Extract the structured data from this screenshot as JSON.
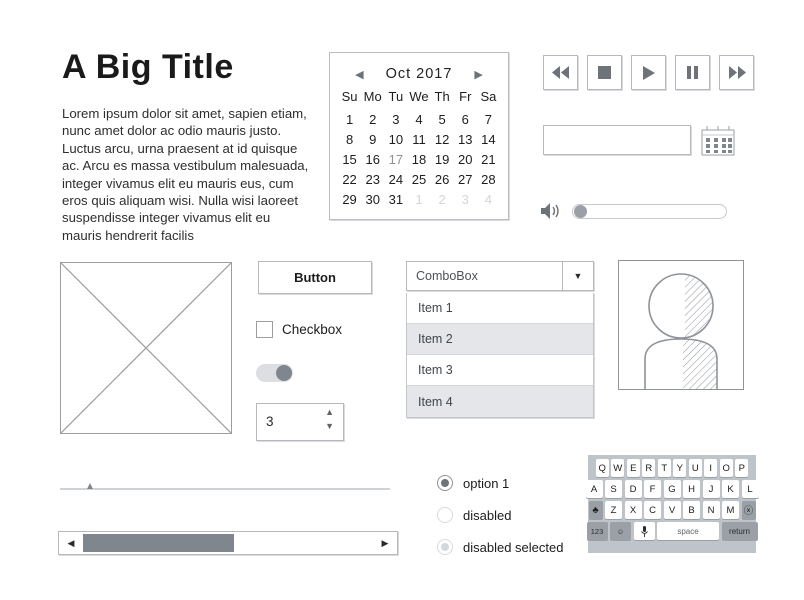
{
  "title": "A Big Title",
  "paragraph": "Lorem ipsum dolor sit amet, sapien etiam, nunc amet dolor ac odio mauris justo. Luctus arcu, urna praesent at id quisque ac. Arcu es massa vestibulum malesuada, integer vivamus elit eu mauris eus, cum eros quis aliquam wisi. Nulla wisi laoreet suspendisse integer vivamus elit eu mauris hendrerit facilis",
  "calendar": {
    "prev_icon": "◀",
    "next_icon": "▶",
    "month": "Oct",
    "year": "2017",
    "month_year": "Oct  2017",
    "weekdays": [
      "Su",
      "Mo",
      "Tu",
      "We",
      "Th",
      "Fr",
      "Sa"
    ],
    "weeks": [
      [
        {
          "d": "1"
        },
        {
          "d": "2"
        },
        {
          "d": "3"
        },
        {
          "d": "4"
        },
        {
          "d": "5"
        },
        {
          "d": "6"
        },
        {
          "d": "7"
        }
      ],
      [
        {
          "d": "8"
        },
        {
          "d": "9"
        },
        {
          "d": "10"
        },
        {
          "d": "11"
        },
        {
          "d": "12"
        },
        {
          "d": "13"
        },
        {
          "d": "14"
        }
      ],
      [
        {
          "d": "15"
        },
        {
          "d": "16"
        },
        {
          "d": "17",
          "state": "today"
        },
        {
          "d": "18"
        },
        {
          "d": "19"
        },
        {
          "d": "20"
        },
        {
          "d": "21"
        }
      ],
      [
        {
          "d": "22"
        },
        {
          "d": "23"
        },
        {
          "d": "24"
        },
        {
          "d": "25"
        },
        {
          "d": "26"
        },
        {
          "d": "27"
        },
        {
          "d": "28"
        }
      ],
      [
        {
          "d": "29"
        },
        {
          "d": "30"
        },
        {
          "d": "31"
        },
        {
          "d": "1",
          "state": "muted"
        },
        {
          "d": "2",
          "state": "muted"
        },
        {
          "d": "3",
          "state": "muted"
        },
        {
          "d": "4",
          "state": "muted"
        }
      ]
    ]
  },
  "media_buttons": [
    {
      "name": "rewind",
      "icon": "rewind-icon"
    },
    {
      "name": "stop",
      "icon": "stop-icon"
    },
    {
      "name": "play",
      "icon": "play-icon"
    },
    {
      "name": "pause",
      "icon": "pause-icon"
    },
    {
      "name": "fast-forward",
      "icon": "fast-forward-icon"
    }
  ],
  "text_field": {
    "value": "",
    "placeholder": ""
  },
  "date_picker_icon": "calendar-icon",
  "volume": {
    "icon": "speaker-icon",
    "value": 5
  },
  "image_placeholder": {
    "icon": "image-placeholder-icon"
  },
  "button": {
    "label": "Button"
  },
  "checkbox": {
    "label": "Checkbox",
    "checked": false
  },
  "toggle": {
    "on": true
  },
  "spinner": {
    "value": "3",
    "up_icon": "▲",
    "down_icon": "▼"
  },
  "combobox": {
    "value": "ComboBox",
    "arrow_icon": "▼",
    "items": [
      {
        "label": "Item 1",
        "alt": false
      },
      {
        "label": "Item 2",
        "alt": true
      },
      {
        "label": "Item 3",
        "alt": false
      },
      {
        "label": "Item 4",
        "alt": true
      }
    ]
  },
  "avatar": {
    "icon": "user-avatar-icon"
  },
  "bottom_slider": {
    "value": 8
  },
  "scrollbar": {
    "left_arrow": "◀",
    "right_arrow": "▶",
    "thumb_percent": 52
  },
  "radios": [
    {
      "label": "option 1",
      "state": "selected"
    },
    {
      "label": "disabled",
      "state": "disabled"
    },
    {
      "label": "disabled selected",
      "state": "disabled-selected"
    }
  ],
  "keyboard": {
    "row1": [
      "Q",
      "W",
      "E",
      "R",
      "T",
      "Y",
      "U",
      "I",
      "O",
      "P"
    ],
    "row2": [
      "A",
      "S",
      "D",
      "F",
      "G",
      "H",
      "J",
      "K",
      "L"
    ],
    "row3_shift": "♣",
    "row3": [
      "Z",
      "X",
      "C",
      "V",
      "B",
      "N",
      "M"
    ],
    "row3_backspace": "ⓧ",
    "numeric_key": "123",
    "emoji_key": "☺",
    "mic_key": " ",
    "space_key": "space",
    "return_key": "return"
  },
  "colors": {
    "ink": "#2b2b2b",
    "line": "#b5b9bd",
    "fill_dark": "#7f868d",
    "row_alt": "#e4e6e9",
    "keyboard_bg": "#bfc4ca"
  }
}
